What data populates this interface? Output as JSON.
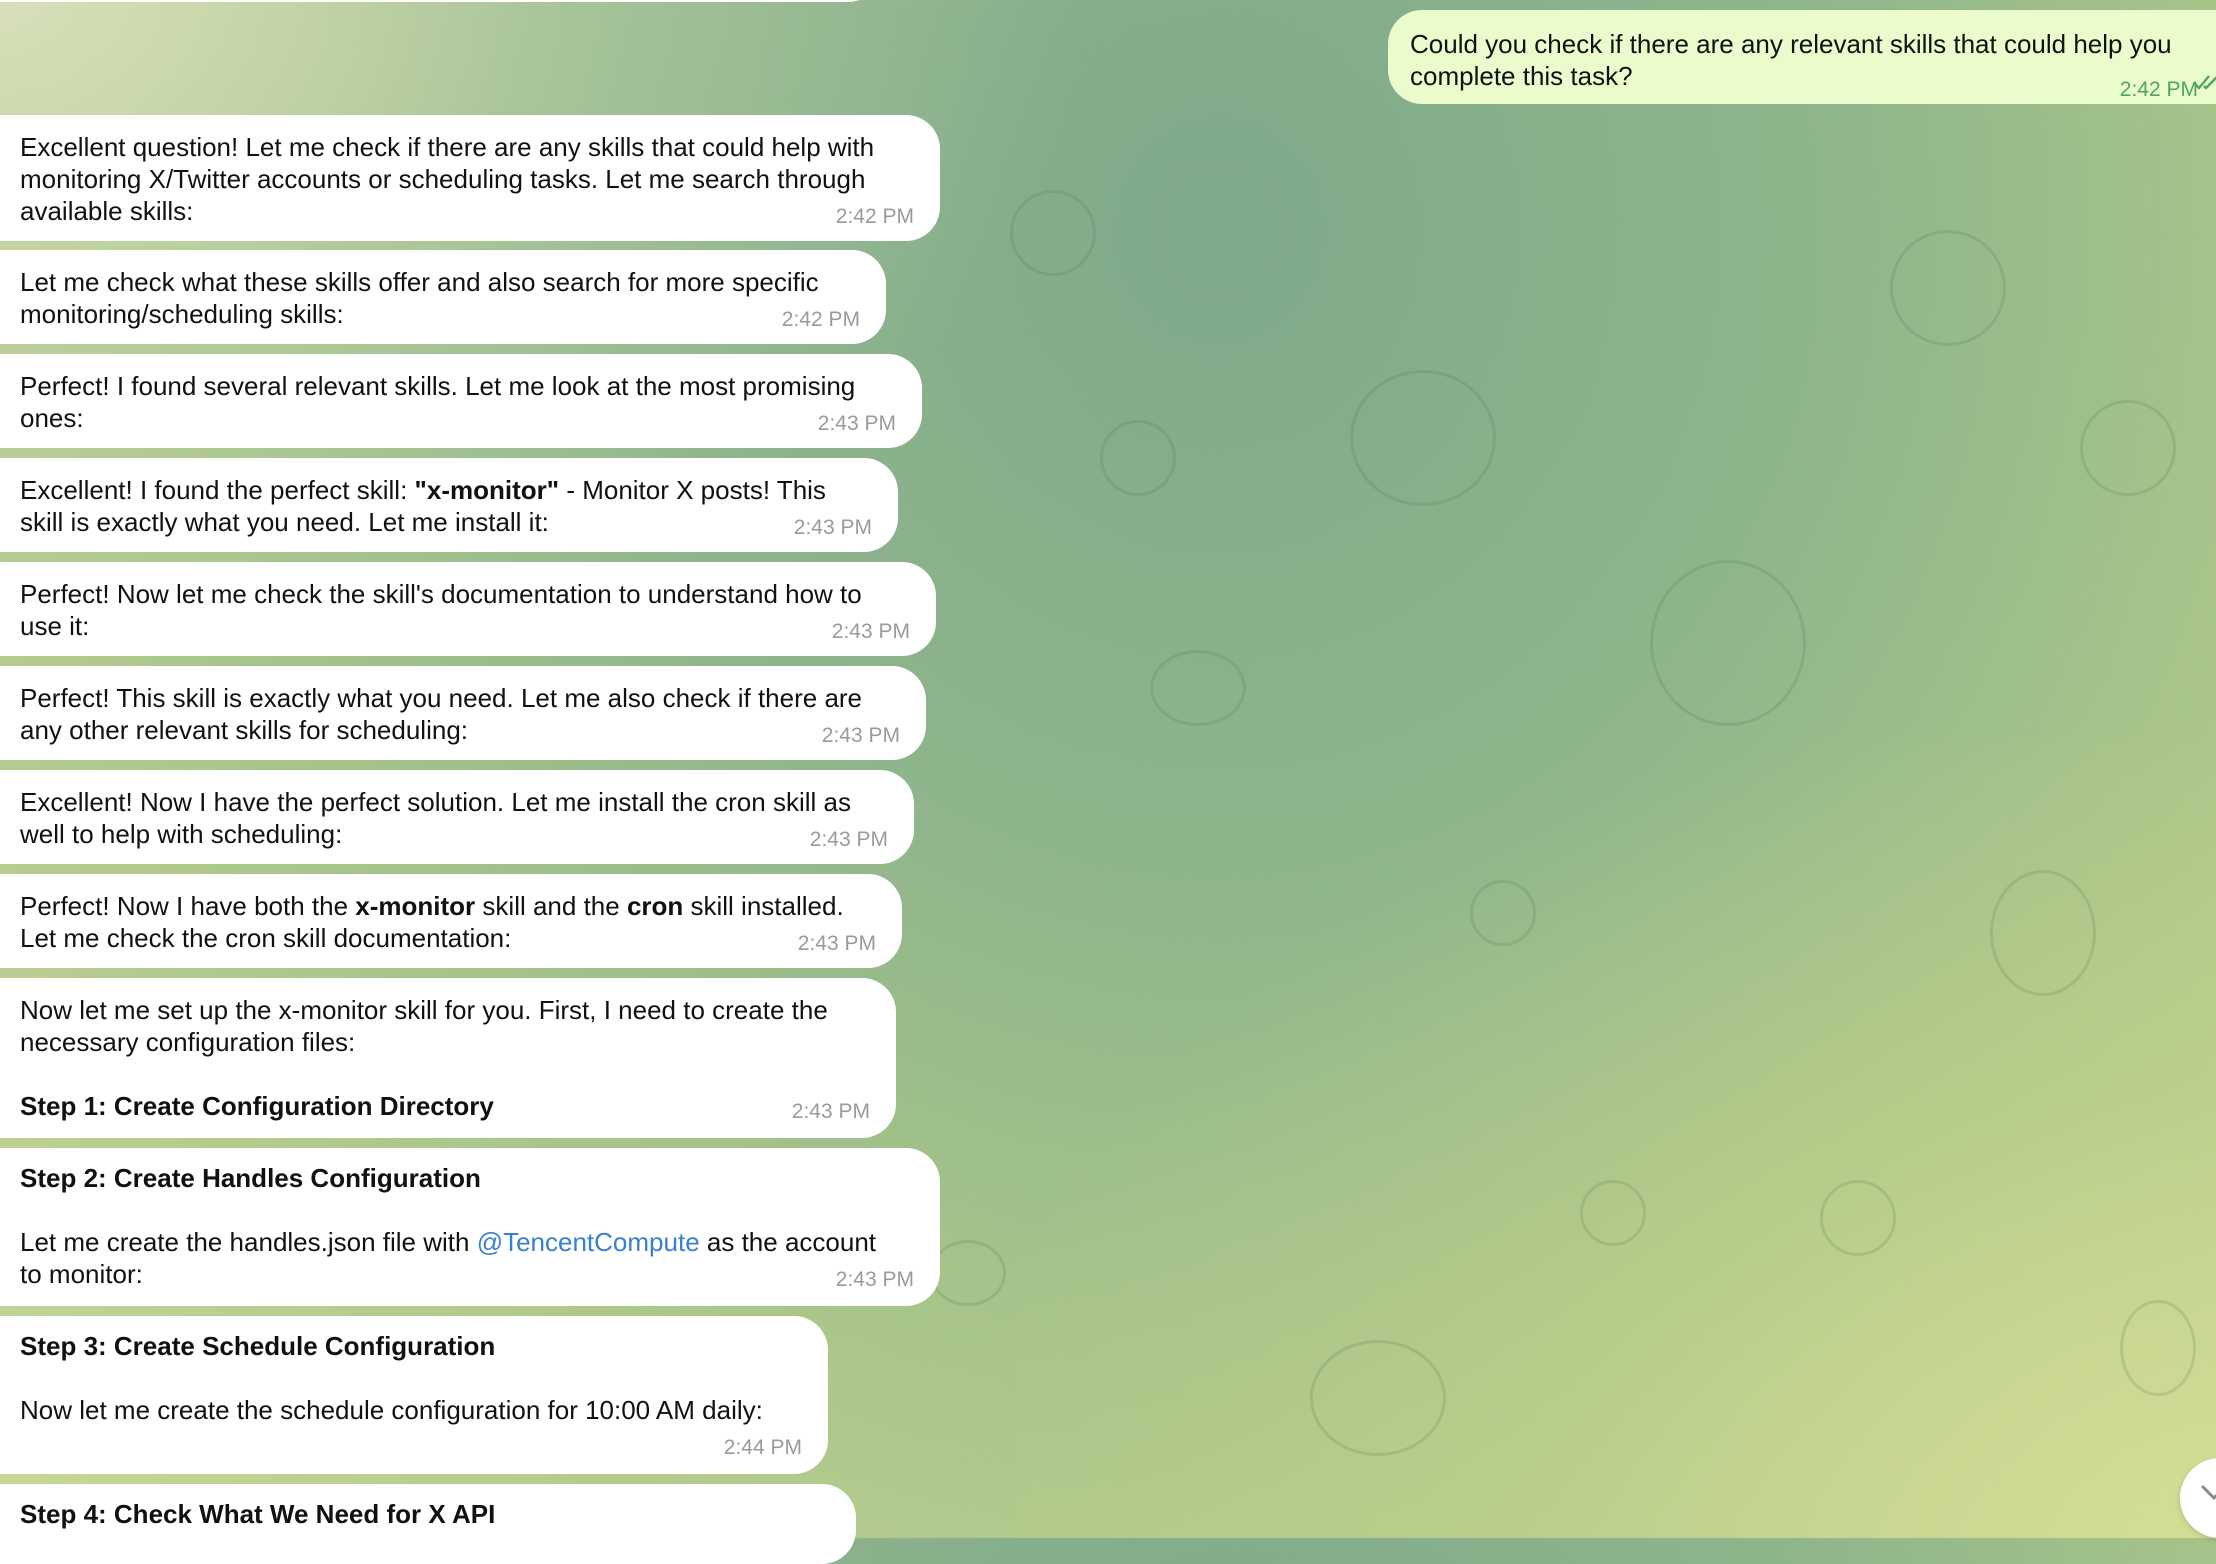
{
  "outgoing": {
    "line1": "Could you check if there are any relevant skills that could help you",
    "line2": "complete this task?",
    "time": "2:42 PM"
  },
  "messages": [
    {
      "lines": [
        "Excellent question! Let me check if there are any skills that could help with",
        "monitoring X/Twitter accounts or scheduling tasks. Let me search through",
        "available skills:"
      ],
      "time": "2:42 PM"
    },
    {
      "lines": [
        "Let me check what these skills offer and also search for more specific",
        "monitoring/scheduling skills:"
      ],
      "time": "2:42 PM"
    },
    {
      "lines": [
        "Perfect! I found several relevant skills. Let me look at the most promising",
        "ones:"
      ],
      "time": "2:43 PM"
    },
    {
      "line1_pre": "Excellent! I found the perfect skill: ",
      "line1_bold": "\"x-monitor\"",
      "line1_post": " - Monitor X posts! This",
      "line2": "skill is exactly what you need. Let me install it:",
      "time": "2:43 PM"
    },
    {
      "lines": [
        "Perfect! Now let me check the skill's documentation to understand how to",
        "use it:"
      ],
      "time": "2:43 PM"
    },
    {
      "lines": [
        "Perfect! This skill is exactly what you need. Let me also check if there are",
        "any other relevant skills for scheduling:"
      ],
      "time": "2:43 PM"
    },
    {
      "lines": [
        "Excellent! Now I have the perfect solution. Let me install the cron skill as",
        "well to help with scheduling:"
      ],
      "time": "2:43 PM"
    },
    {
      "l1_a": "Perfect! Now I have both the ",
      "l1_b": "x-monitor",
      "l1_c": " skill and the ",
      "l1_d": "cron",
      "l1_e": " skill installed.",
      "line2": "Let me check the cron skill documentation:",
      "time": "2:43 PM"
    },
    {
      "lines": [
        "Now let me set up the x-monitor skill for you. First, I need to create the",
        "necessary configuration files:"
      ],
      "heading": "Step 1: Create Configuration Directory",
      "time": "2:43 PM"
    },
    {
      "heading": "Step 2: Create Handles Configuration",
      "pre": "Let me create the handles.json file with ",
      "link": "@TencentCompute",
      "post": " as the account",
      "line2": "to monitor:",
      "time": "2:43 PM"
    },
    {
      "heading": "Step 3: Create Schedule Configuration",
      "line": "Now let me create the schedule configuration for 10:00 AM daily:",
      "time": "2:44 PM"
    },
    {
      "heading": "Step 4: Check What We Need for X API"
    }
  ]
}
